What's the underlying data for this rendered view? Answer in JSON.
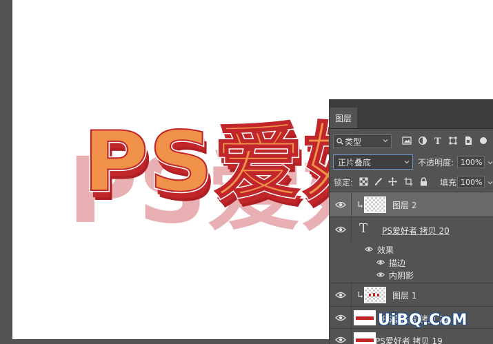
{
  "canvas": {
    "artwork_text": "PS爱好",
    "colors": {
      "face": "#f0924a",
      "extrude": "#c0262a",
      "shadow": "#e9b0b4",
      "outline": "#ffffff"
    }
  },
  "panel": {
    "tab_label": "图层",
    "filter_label": "类型",
    "blend_mode": "正片叠底",
    "opacity_label": "不透明度:",
    "opacity_value": "100%",
    "lock_label": "锁定:",
    "fill_label": "填充:",
    "fill_value": "100%",
    "layers": [
      {
        "name": "图层 2",
        "selected": true
      },
      {
        "name": "PS爱好者 拷贝 20",
        "type": "text"
      },
      {
        "effects_label": "效果",
        "effects": [
          "描边",
          "内阴影"
        ]
      },
      {
        "name": "图层 1"
      },
      {
        "name": "PS爱好者 拷贝 21"
      },
      {
        "name": "PS爱好者 拷贝 19"
      }
    ]
  },
  "watermark": "UiBQ.CoM",
  "icons": [
    "search-icon",
    "image-filter-icon",
    "adjustment-filter-icon",
    "text-filter-icon",
    "shape-filter-icon",
    "smart-object-filter-icon",
    "eye-icon",
    "text-layer-icon",
    "clip-arrow-icon",
    "lock-pixels-icon",
    "brush-icon",
    "move-icon",
    "artboard-icon",
    "lock-icon"
  ]
}
